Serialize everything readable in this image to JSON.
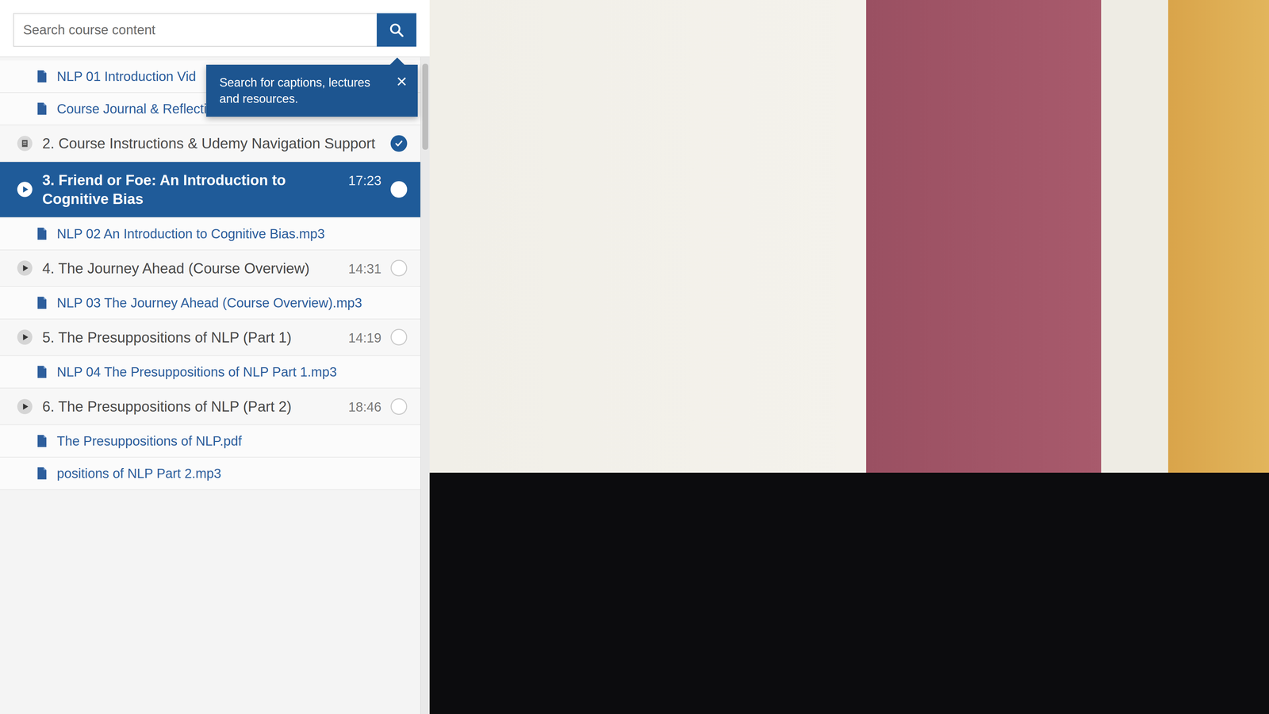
{
  "search": {
    "placeholder": "Search course content"
  },
  "tooltip": {
    "text": "Search for captions, lectures and resources.",
    "close": "×"
  },
  "items": [
    {
      "kind": "resource",
      "title": "NLP 01 Introduction Vid",
      "selected": false
    },
    {
      "kind": "resource",
      "title": "Course Journal & Reflection Log.pdf",
      "selected": false
    },
    {
      "kind": "article",
      "title": "2. Course Instructions & Udemy Navigation Support",
      "selected": false,
      "completed": true
    },
    {
      "kind": "video",
      "title": "3. Friend or Foe: An Introduction to Cognitive Bias",
      "duration": "17:23",
      "selected": true,
      "completed": false
    },
    {
      "kind": "resource",
      "title": "NLP 02 An Introduction to Cognitive Bias.mp3",
      "selected": false
    },
    {
      "kind": "video",
      "title": "4. The Journey Ahead (Course Overview)",
      "duration": "14:31",
      "selected": false,
      "completed": false
    },
    {
      "kind": "resource",
      "title": "NLP 03 The Journey Ahead (Course Overview).mp3",
      "selected": false
    },
    {
      "kind": "video",
      "title": "5. The Presuppositions of NLP (Part 1)",
      "duration": "14:19",
      "selected": false,
      "completed": false
    },
    {
      "kind": "resource",
      "title": "NLP 04 The Presuppositions of NLP Part 1.mp3",
      "selected": false
    },
    {
      "kind": "video",
      "title": "6. The Presuppositions of NLP (Part 2)",
      "duration": "18:46",
      "selected": false,
      "completed": false
    },
    {
      "kind": "resource",
      "title": "The Presuppositions of NLP.pdf",
      "selected": false
    },
    {
      "kind": "resource",
      "title": "positions of NLP Part 2.mp3",
      "selected": false
    }
  ]
}
